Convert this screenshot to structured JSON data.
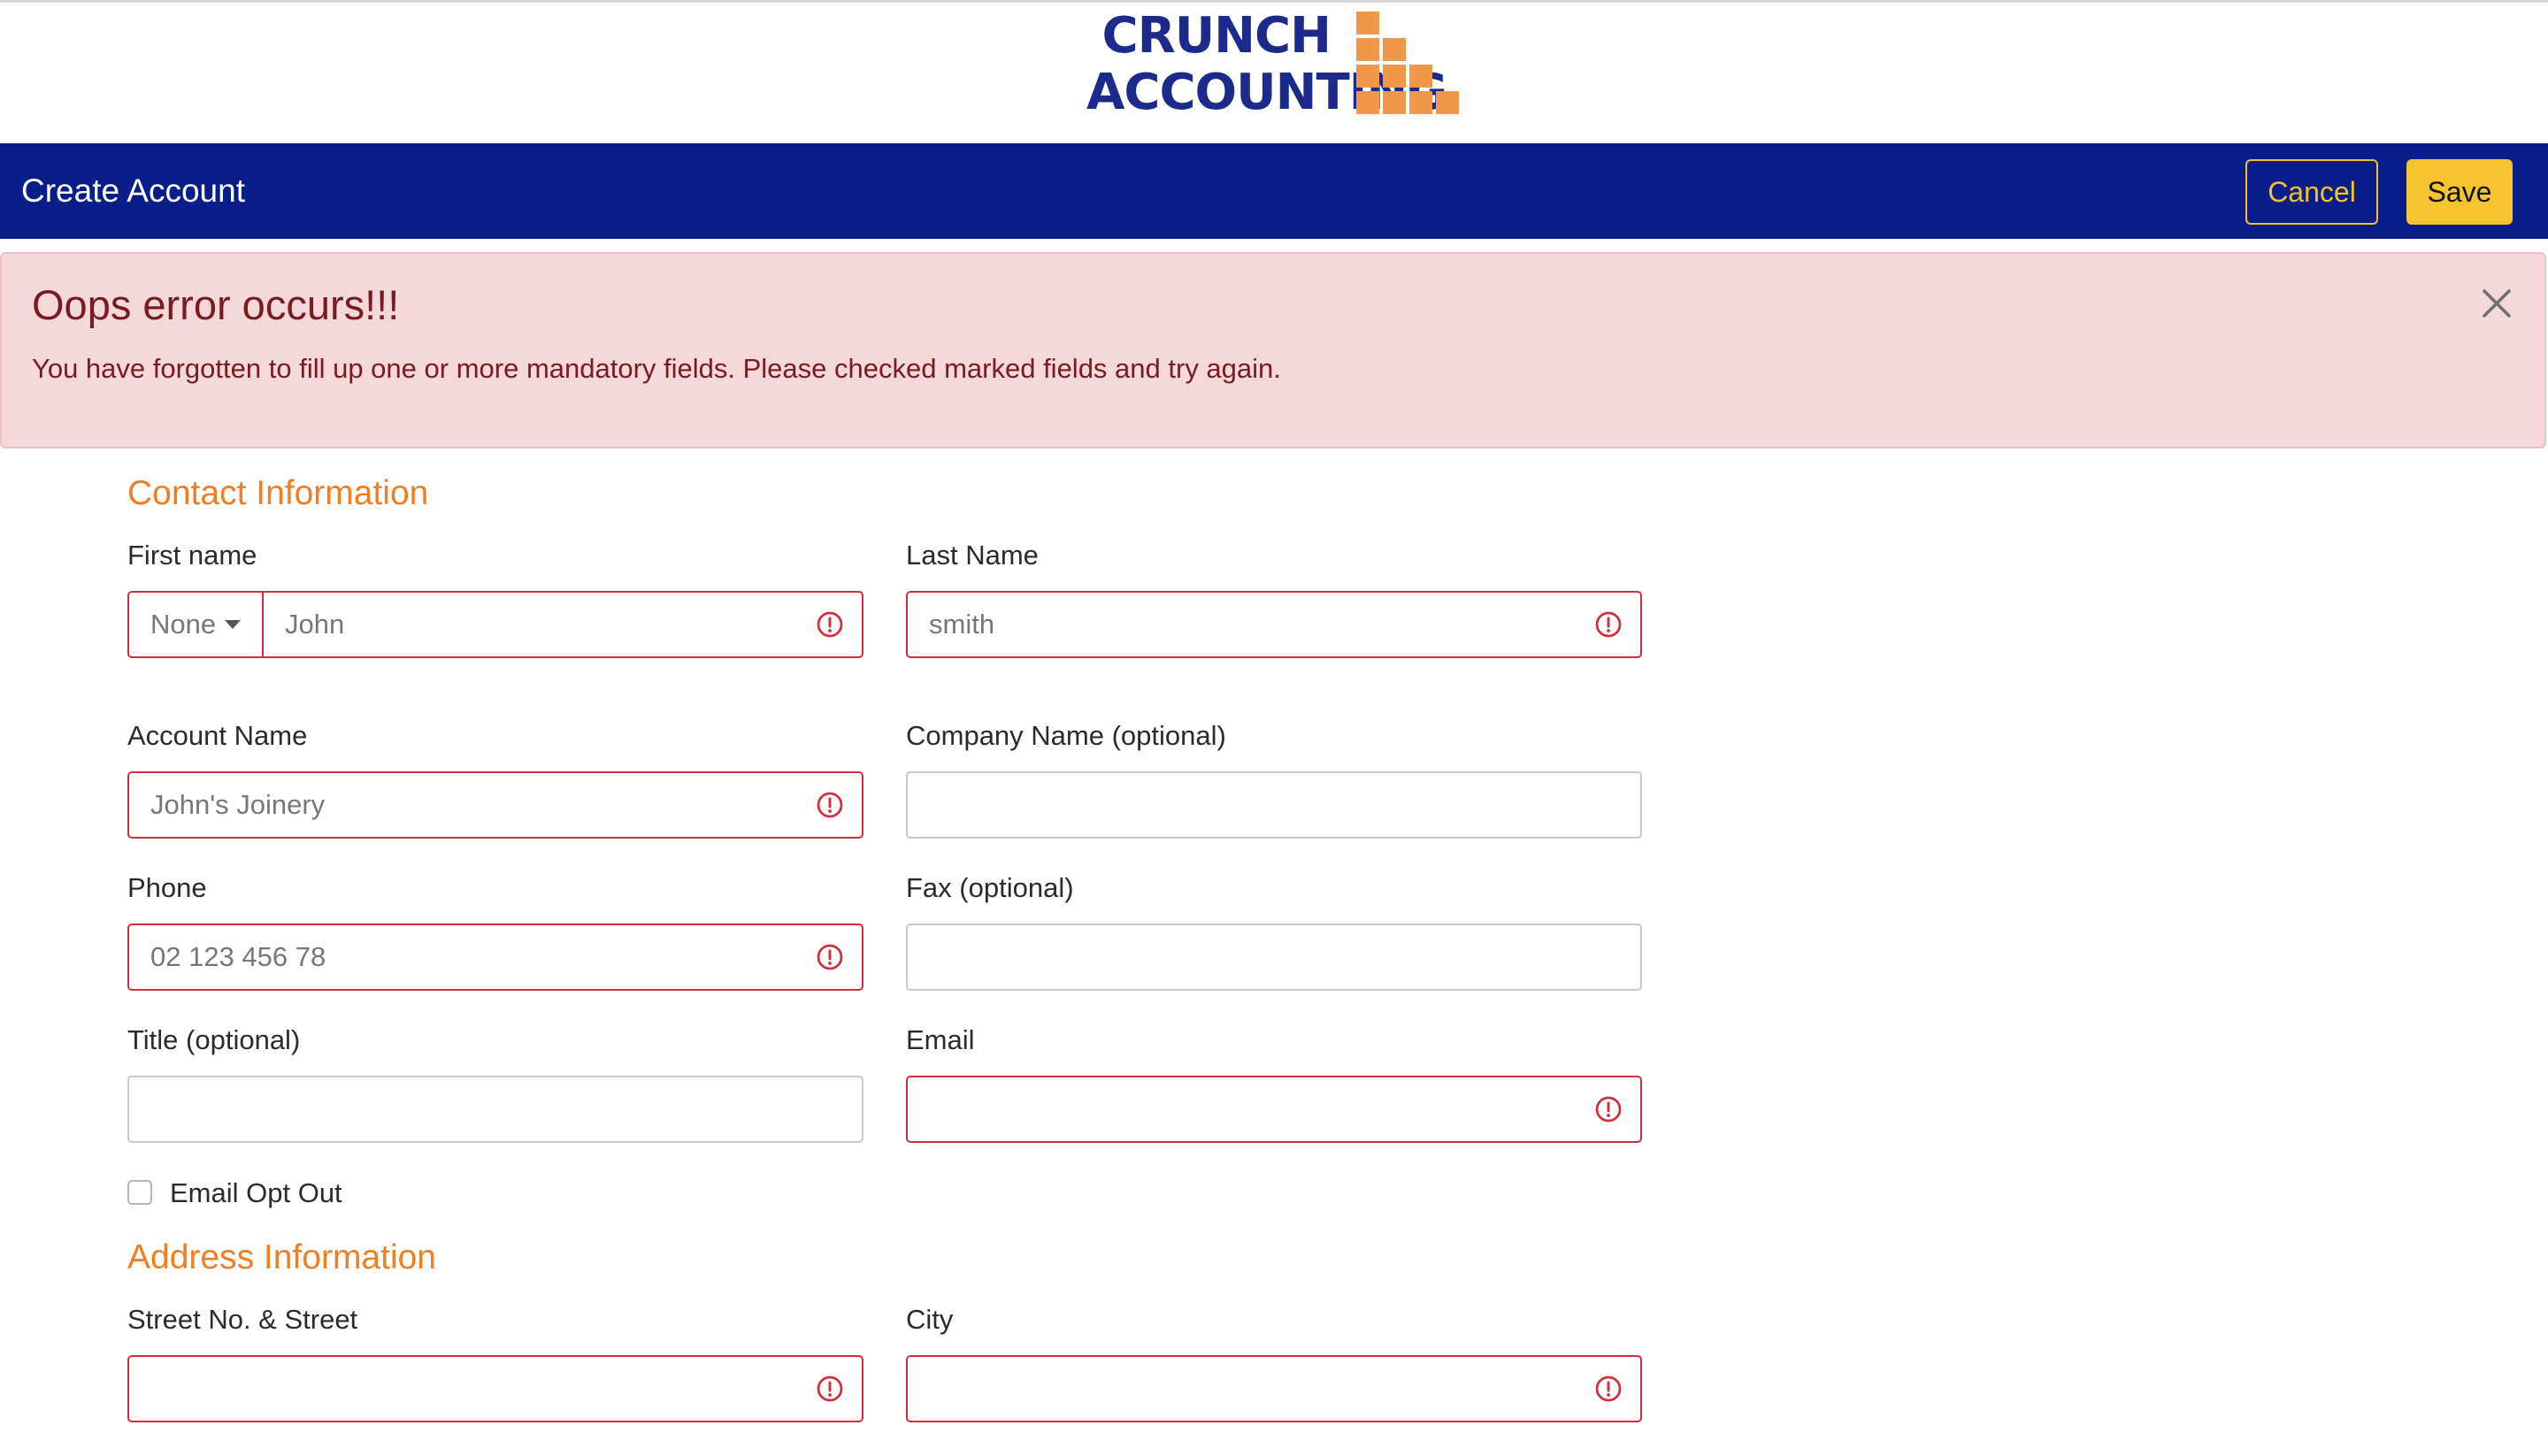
{
  "brand": {
    "line1": "CRUNCH",
    "line2": "ACCOUNTING",
    "color": "#1c2a8c",
    "mark_color": "#f0974a"
  },
  "header": {
    "title": "Create Account",
    "cancel_label": "Cancel",
    "save_label": "Save",
    "background": "#0a1e8a",
    "accent": "#f6c42e"
  },
  "error": {
    "title": "Oops error occurs!!!",
    "message": "You have forgotten to fill up one or more mandatory fields. Please checked marked fields and try again.",
    "close_icon": "close-icon"
  },
  "contact": {
    "section_title": "Contact Information",
    "first_name": {
      "label": "First name",
      "prefix": "None",
      "value": "John",
      "error": true
    },
    "last_name": {
      "label": "Last Name",
      "value": "smith",
      "error": true
    },
    "account_name": {
      "label": "Account Name",
      "value": "John's Joinery",
      "error": true
    },
    "company_name": {
      "label": "Company Name (optional)",
      "value": "",
      "error": false
    },
    "phone": {
      "label": "Phone",
      "value": "02 123 456 78",
      "error": true
    },
    "fax": {
      "label": "Fax (optional)",
      "value": "",
      "error": false
    },
    "title": {
      "label": "Title (optional)",
      "value": "",
      "error": false
    },
    "email": {
      "label": "Email",
      "value": "",
      "error": true
    },
    "email_opt_out": {
      "label": "Email Opt Out",
      "checked": false
    }
  },
  "address": {
    "section_title": "Address Information",
    "street": {
      "label": "Street No. & Street",
      "value": "",
      "error": true
    },
    "city": {
      "label": "City",
      "value": "",
      "error": true
    }
  },
  "colors": {
    "error_border": "#d0303e",
    "section_title": "#f07e22",
    "error_banner_bg": "#f4d8da",
    "error_text": "#7a1b21"
  }
}
